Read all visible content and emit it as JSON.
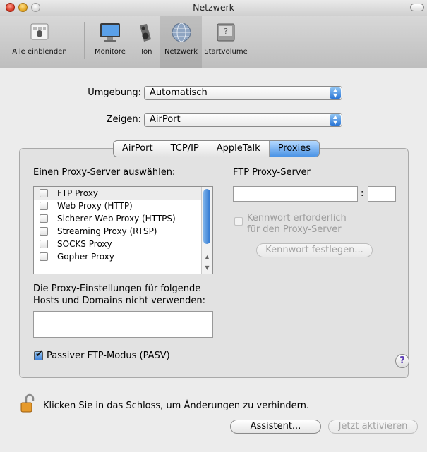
{
  "window": {
    "title": "Netzwerk"
  },
  "toolbar": {
    "items": [
      {
        "label": "Alle einblenden",
        "icon": "show-all-icon"
      },
      {
        "label": "Monitore",
        "icon": "monitor-icon"
      },
      {
        "label": "Ton",
        "icon": "speaker-icon"
      },
      {
        "label": "Netzwerk",
        "icon": "network-globe-icon",
        "selected": true
      },
      {
        "label": "Startvolume",
        "icon": "startup-disk-icon"
      }
    ]
  },
  "location": {
    "label": "Umgebung:",
    "value": "Automatisch"
  },
  "show": {
    "label": "Zeigen:",
    "value": "AirPort"
  },
  "tabs": [
    {
      "label": "AirPort"
    },
    {
      "label": "TCP/IP"
    },
    {
      "label": "AppleTalk"
    },
    {
      "label": "Proxies",
      "selected": true
    }
  ],
  "proxies": {
    "select_label": "Einen Proxy-Server auswählen:",
    "list": [
      "FTP Proxy",
      "Web Proxy (HTTP)",
      "Sicherer Web Proxy (HTTPS)",
      "Streaming Proxy (RTSP)",
      "SOCKS Proxy",
      "Gopher Proxy"
    ],
    "server_title": "FTP Proxy-Server",
    "port_separator": ":",
    "password_checkbox": "Kennwort erforderlich",
    "password_checkbox_line2": "für den Proxy-Server",
    "set_password_button": "Kennwort festlegen...",
    "bypass_label_line1": "Die Proxy-Einstellungen für folgende",
    "bypass_label_line2": "Hosts und Domains nicht verwenden:",
    "passive_ftp": "Passiver FTP-Modus (PASV)",
    "passive_ftp_checked": true,
    "help": "?"
  },
  "footer": {
    "lock_text": "Klicken Sie in das Schloss, um Änderungen zu verhindern.",
    "assist_button": "Assistent...",
    "apply_button": "Jetzt aktivieren"
  },
  "colors": {
    "accent": "#3f82d9",
    "window_bg": "#ececec"
  }
}
